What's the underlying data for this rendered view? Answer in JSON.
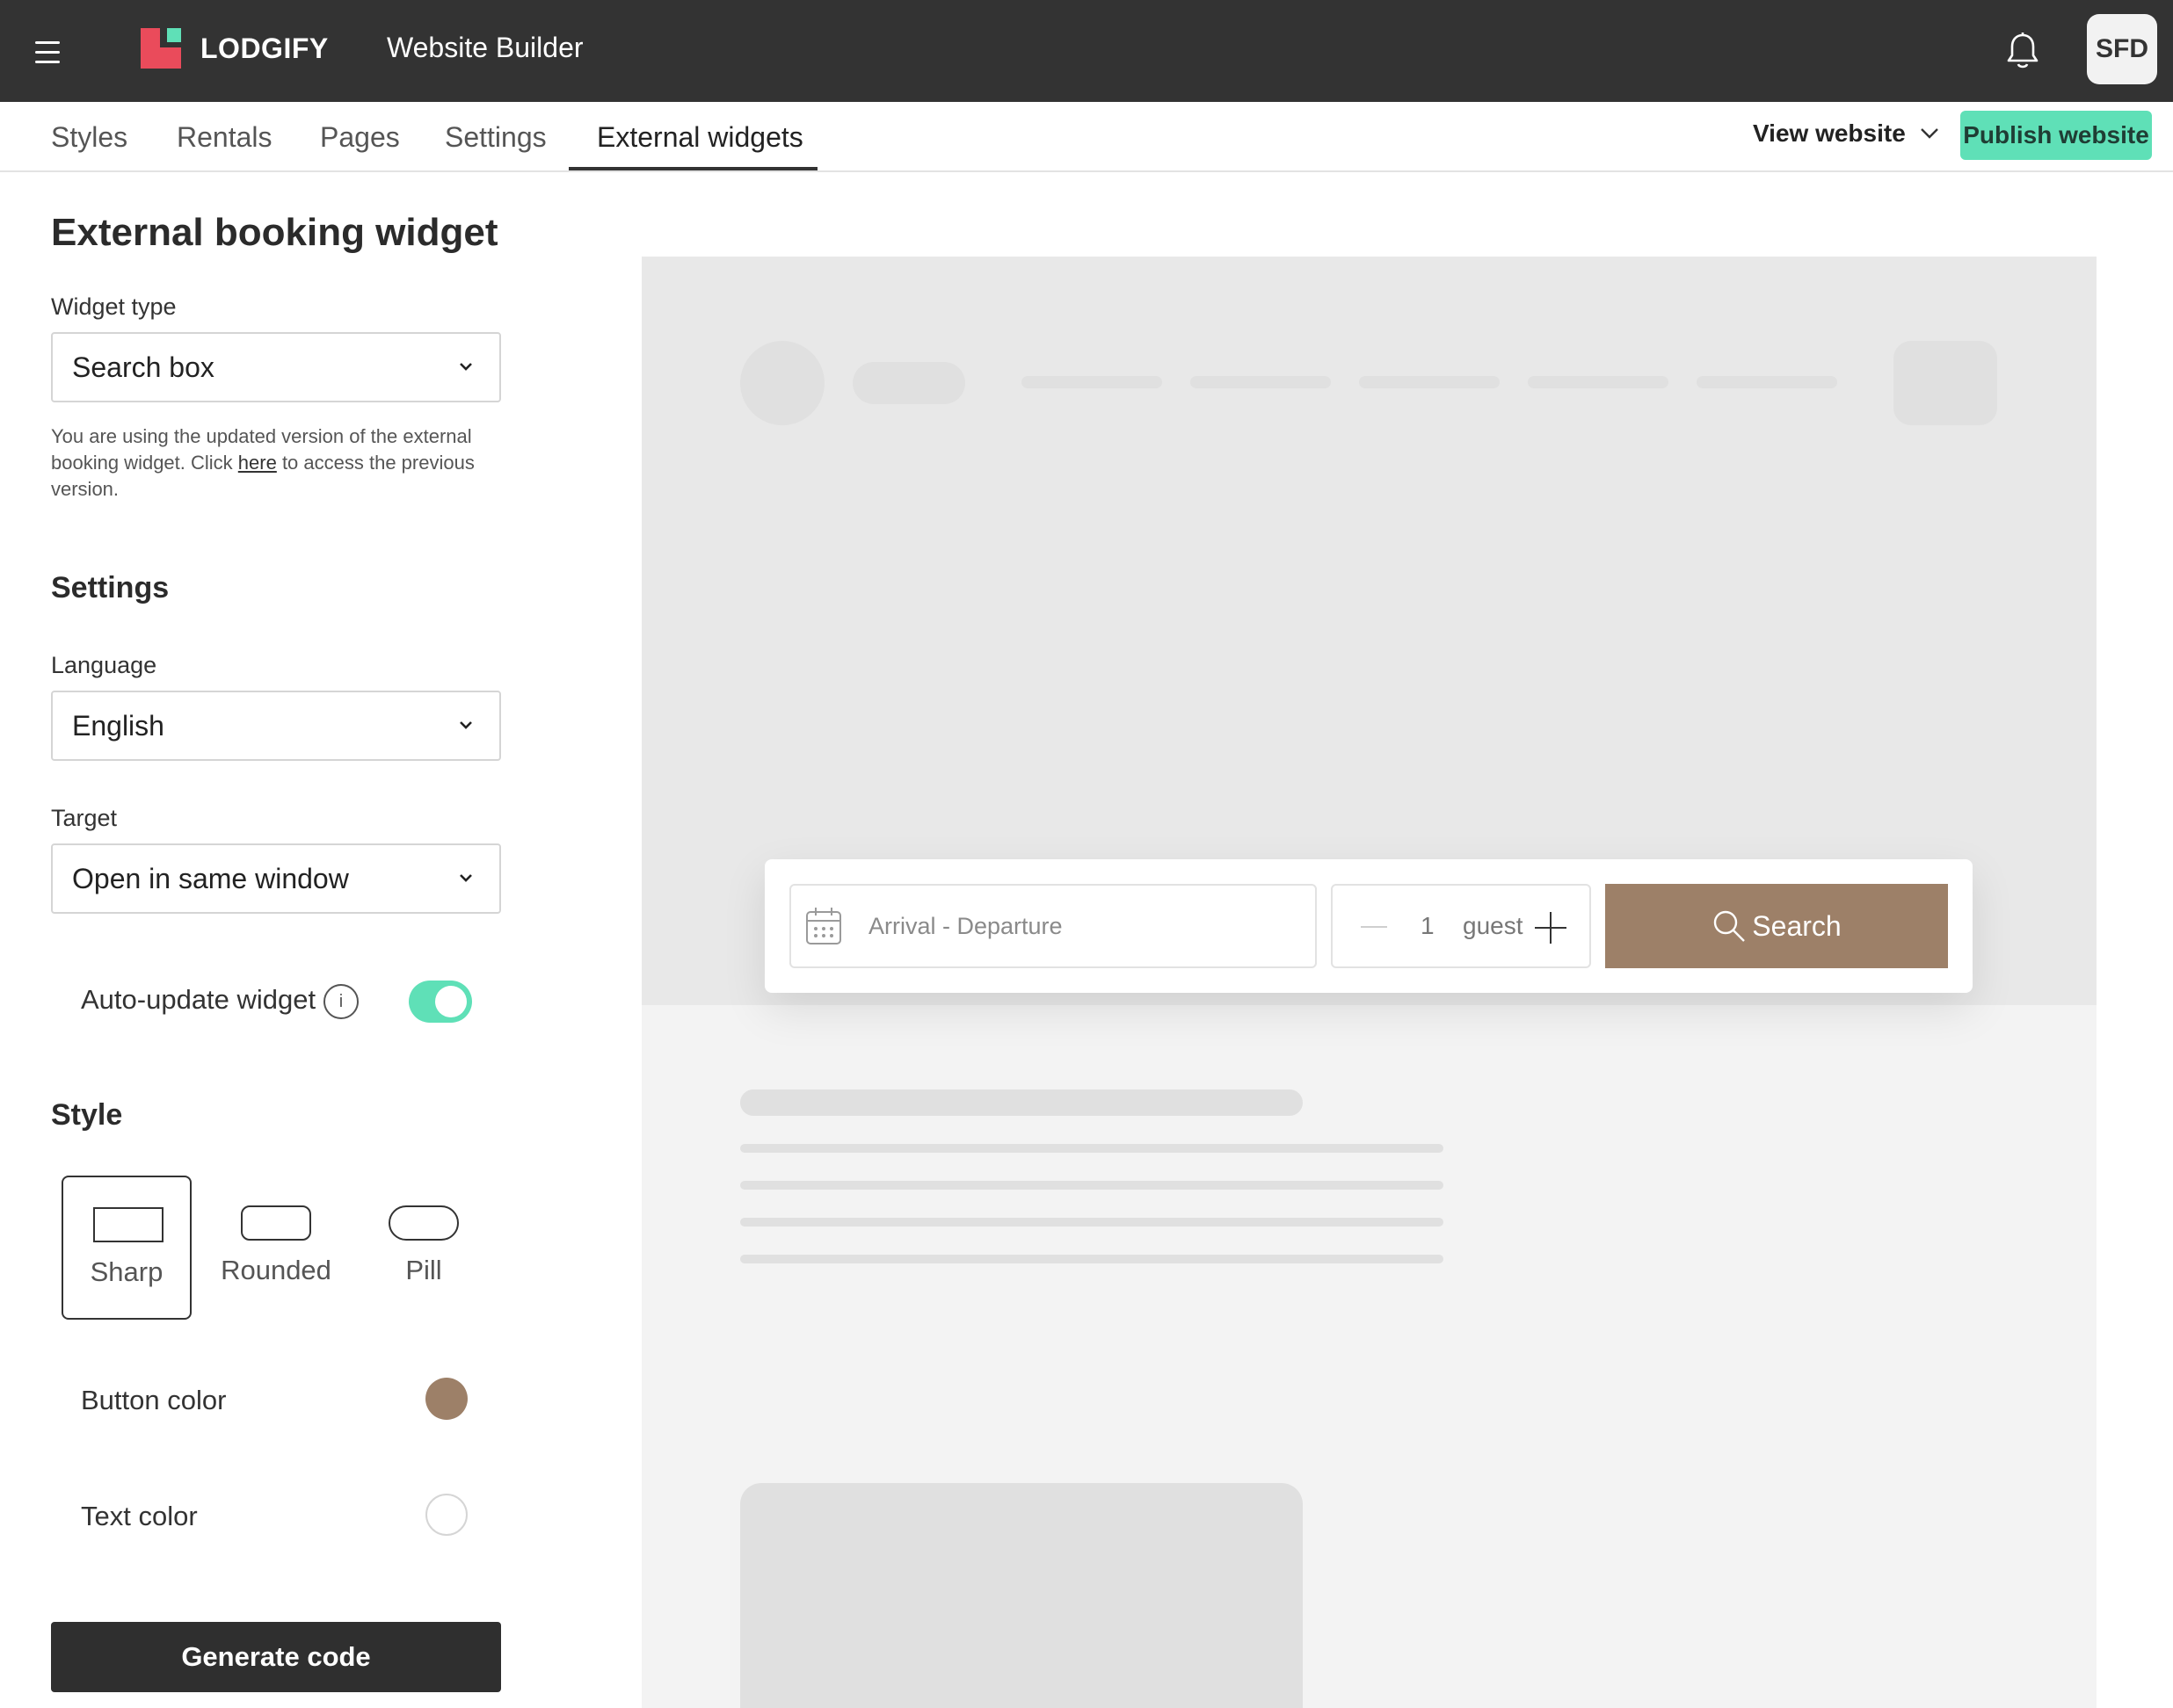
{
  "header": {
    "logo_text": "LODGIFY",
    "app_title": "Website Builder",
    "avatar_initials": "SFD"
  },
  "tabs": [
    {
      "label": "Styles"
    },
    {
      "label": "Rentals"
    },
    {
      "label": "Pages"
    },
    {
      "label": "Settings"
    },
    {
      "label": "External widgets",
      "active": true
    }
  ],
  "toolbar": {
    "view_website_label": "View website",
    "publish_label": "Publish website"
  },
  "panel": {
    "title": "External booking widget",
    "widget_type": {
      "label": "Widget type",
      "value": "Search box"
    },
    "note_before": "You are using the updated version of the external booking widget. Click ",
    "note_link": "here",
    "note_after": " to access the previous version.",
    "settings_heading": "Settings",
    "language": {
      "label": "Language",
      "value": "English"
    },
    "target": {
      "label": "Target",
      "value": "Open in same window"
    },
    "auto_update": {
      "label": "Auto-update widget",
      "enabled": true
    },
    "style_heading": "Style",
    "style_options": [
      {
        "label": "Sharp",
        "selected": true
      },
      {
        "label": "Rounded",
        "selected": false
      },
      {
        "label": "Pill",
        "selected": false
      }
    ],
    "button_color": {
      "label": "Button color",
      "value": "#9d8068"
    },
    "text_color": {
      "label": "Text color",
      "value": "#ffffff"
    },
    "generate_label": "Generate code"
  },
  "preview": {
    "date_placeholder": "Arrival - Departure",
    "guest_count": "1",
    "guest_unit": "guest",
    "search_label": "Search"
  },
  "colors": {
    "topbar": "#333333",
    "accent": "#5fe0b7",
    "logo_red": "#ea4b5b"
  }
}
